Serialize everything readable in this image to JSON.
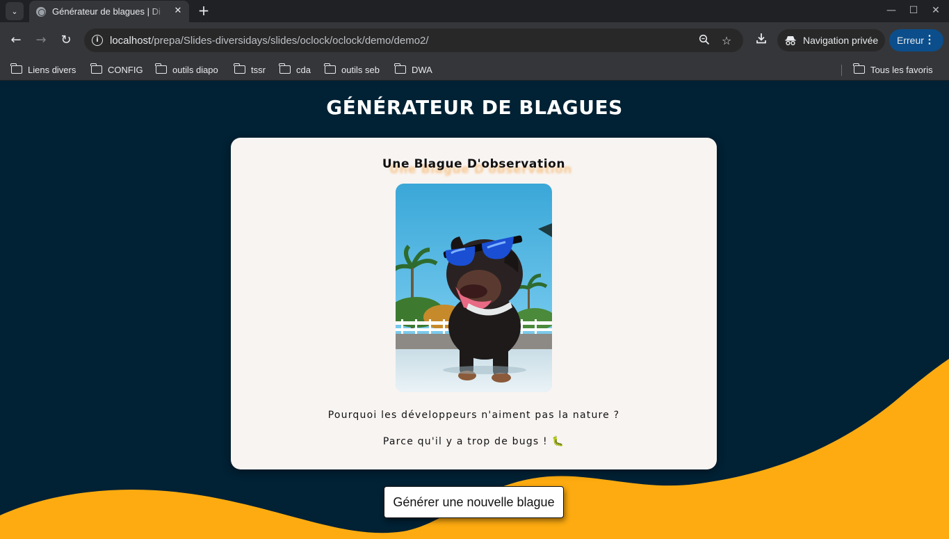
{
  "browser": {
    "tab_title": "Générateur de blagues | Di",
    "tab_close": "✕",
    "new_tab": "+",
    "url_host": "localhost",
    "url_path": "/prepa/Slides-diversidays/slides/oclock/oclock/demo/demo2/",
    "private_label": "Navigation privée",
    "error_label": "Erreur"
  },
  "bookmarks": {
    "items": [
      "Liens divers",
      "CONFIG",
      "outils diapo",
      "tssr",
      "cda",
      "outils seb",
      "DWA"
    ],
    "all_favorites": "Tous les favoris"
  },
  "page": {
    "title": "GÉNÉRATEUR DE BLAGUES",
    "joke_type": "Une Blague D'observation",
    "setup": "Pourquoi les développeurs n'aiment pas la nature ?",
    "punchline": "Parce qu'il y a trop de bugs ! 🐛",
    "button_label": "Générer une nouvelle blague",
    "colors": {
      "background": "#012134",
      "wave": "#fdab10",
      "card": "#f8f4f2"
    }
  }
}
